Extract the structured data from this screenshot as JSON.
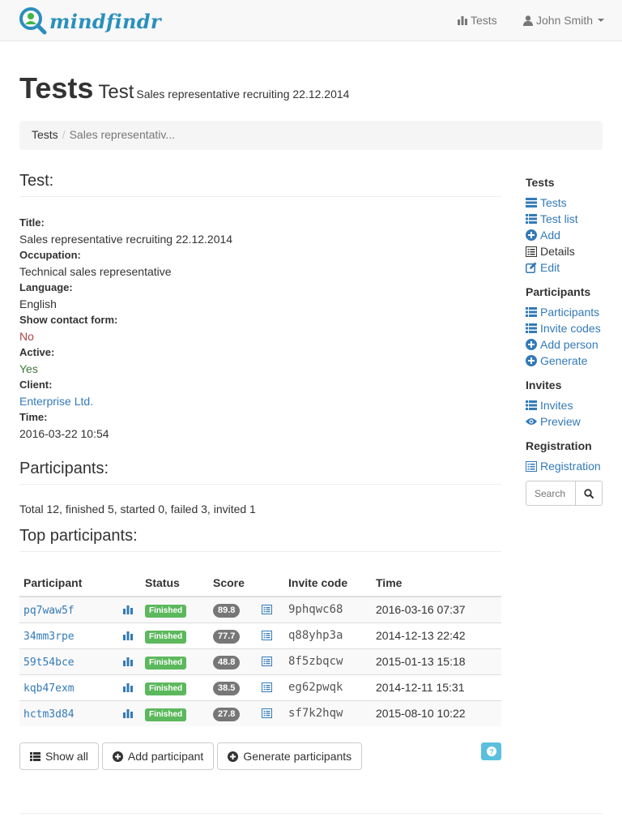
{
  "navbar": {
    "brand": "mindfindr",
    "tests_label": "Tests",
    "user_name": "John Smith"
  },
  "header": {
    "title": "Tests",
    "subtitle": "Test",
    "subtitle_small": "Sales representative recruiting 22.12.2014"
  },
  "breadcrumb": {
    "home": "Tests",
    "separator": "/",
    "current": "Sales representativ..."
  },
  "test_section": {
    "heading": "Test:",
    "fields": [
      {
        "label": "Title:",
        "value": "Sales representative recruiting 22.12.2014"
      },
      {
        "label": "Occupation:",
        "value": "Technical sales representative"
      },
      {
        "label": "Language:",
        "value": "English"
      },
      {
        "label": "Show contact form:",
        "value": "No"
      },
      {
        "label": "Active:",
        "value": "Yes"
      },
      {
        "label": "Client:",
        "value": "Enterprise Ltd."
      },
      {
        "label": "Time:",
        "value": "2016-03-22 10:54"
      }
    ]
  },
  "participants_section": {
    "heading": "Participants:",
    "summary": "Total 12, finished 5, started 0, failed 3, invited 1",
    "top_heading": "Top participants:"
  },
  "table": {
    "headers": [
      "Participant",
      "",
      "Status",
      "Score",
      "",
      "Invite code",
      "Time"
    ],
    "rows": [
      {
        "participant": "pq7waw5f",
        "status": "Finished",
        "score": "89.8",
        "invite_code": "9phqwc68",
        "time": "2016-03-16 07:37"
      },
      {
        "participant": "34mm3rpe",
        "status": "Finished",
        "score": "77.7",
        "invite_code": "q88yhp3a",
        "time": "2014-12-13 22:42"
      },
      {
        "participant": "59t54bce",
        "status": "Finished",
        "score": "48.8",
        "invite_code": "8f5zbqcw",
        "time": "2015-01-13 15:18"
      },
      {
        "participant": "kqb47exm",
        "status": "Finished",
        "score": "38.5",
        "invite_code": "eg62pwqk",
        "time": "2014-12-11 15:31"
      },
      {
        "participant": "hctm3d84",
        "status": "Finished",
        "score": "27.8",
        "invite_code": "sf7k2hqw",
        "time": "2015-08-10 10:22"
      }
    ]
  },
  "actions": {
    "show_all": "Show all",
    "add_participant": "Add participant",
    "generate_participants": "Generate participants"
  },
  "sidebar": {
    "tests": {
      "heading": "Tests",
      "items": [
        "Tests",
        "Test list",
        "Add",
        "Details",
        "Edit"
      ]
    },
    "participants": {
      "heading": "Participants",
      "items": [
        "Participants",
        "Invite codes",
        "Add person",
        "Generate"
      ]
    },
    "invites": {
      "heading": "Invites",
      "items": [
        "Invites",
        "Preview"
      ]
    },
    "registration": {
      "heading": "Registration",
      "items": [
        "Registration"
      ]
    },
    "search_placeholder": "Search"
  },
  "colors": {
    "brand": "#2a8fbd",
    "link": "#337ab7",
    "success": "#5cb85c",
    "danger_text": "#a94442",
    "success_text": "#3c763d",
    "badge": "#777777",
    "info": "#5bc0de"
  }
}
